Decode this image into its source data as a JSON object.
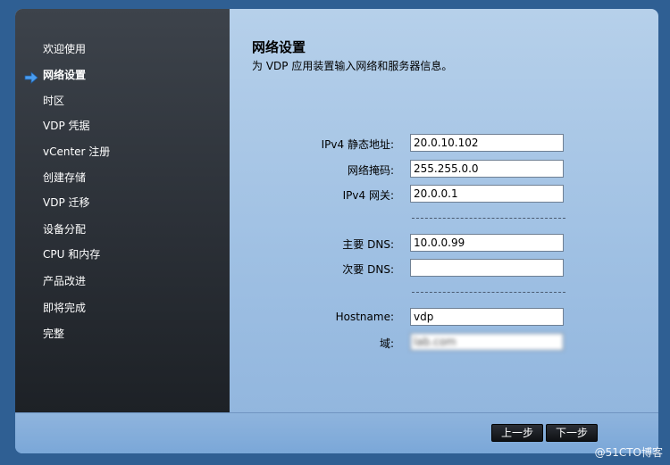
{
  "sidebar": {
    "items": [
      {
        "label": "欢迎使用",
        "active": false
      },
      {
        "label": "网络设置",
        "active": true
      },
      {
        "label": "时区",
        "active": false
      },
      {
        "label": "VDP 凭据",
        "active": false
      },
      {
        "label": "vCenter 注册",
        "active": false
      },
      {
        "label": "创建存储",
        "active": false
      },
      {
        "label": "VDP 迁移",
        "active": false
      },
      {
        "label": "设备分配",
        "active": false
      },
      {
        "label": "CPU 和内存",
        "active": false
      },
      {
        "label": "产品改进",
        "active": false
      },
      {
        "label": "即将完成",
        "active": false
      },
      {
        "label": "完整",
        "active": false
      }
    ],
    "active_icon": "arrow-right-icon"
  },
  "main": {
    "title": "网络设置",
    "subtitle": "为 VDP 应用装置输入网络和服务器信息。",
    "fields": {
      "ipv4_address": {
        "label": "IPv4 静态地址:",
        "value": "20.0.10.102"
      },
      "netmask": {
        "label": "网络掩码:",
        "value": "255.255.0.0"
      },
      "gateway": {
        "label": "IPv4 网关:",
        "value": "20.0.0.1"
      },
      "primary_dns": {
        "label": "主要 DNS:",
        "value": "10.0.0.99"
      },
      "secondary_dns": {
        "label": "次要 DNS:",
        "value": ""
      },
      "hostname": {
        "label": "Hostname:",
        "value": "vdp"
      },
      "domain": {
        "label": "域:",
        "value": "lab.com"
      }
    }
  },
  "footer": {
    "back_label": "上一步",
    "next_label": "下一步"
  },
  "watermark": "@51CTO博客",
  "colors": {
    "arrow": "#4a9df0",
    "sidebar_top": "#3d434b",
    "sidebar_bottom": "#1d2126",
    "content_bg": "#a8c7e6"
  }
}
